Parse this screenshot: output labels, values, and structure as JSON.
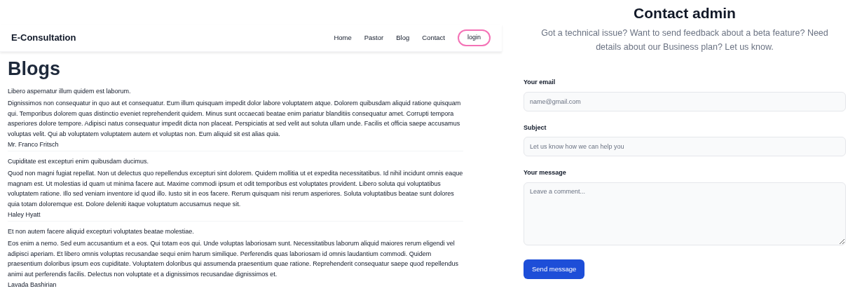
{
  "navbar": {
    "brand": "E-Consultation",
    "links": [
      {
        "label": "Home"
      },
      {
        "label": "Pastor"
      },
      {
        "label": "Blog"
      },
      {
        "label": "Contact"
      }
    ],
    "login": "login"
  },
  "blogs": {
    "heading": "Blogs",
    "posts": [
      {
        "title": "Libero aspernatur illum quidem est laborum.",
        "body": "Dignissimos non consequatur in quo aut et consequatur. Eum illum quisquam impedit dolor labore voluptatem atque. Dolorem quibusdam aliquid ratione quisquam qui. Temporibus dolorem quas distinctio eveniet reprehenderit quidem. Minus sunt occaecati beatae enim pariatur blanditiis consequatur amet. Corrupti tempora asperiores dolore tempore. Adipisci natus consequatur impedit dicta non placeat. Perspiciatis at sed velit aut soluta ullam unde. Facilis et officia saepe accusamus voluptas velit. Qui ab voluptatem voluptatem autem et voluptas non. Eum aliquid sit est alias quia.",
        "author": "Mr. Franco Fritsch"
      },
      {
        "title": "Cupiditate est excepturi enim quibusdam ducimus.",
        "body": "Quod non magni fugiat repellat. Non ut delectus quo repellendus excepturi sint dolorem. Quidem mollitia ut et expedita necessitatibus. Id nihil incidunt omnis eaque magnam est. Ut molestias id quam ut minima facere aut. Maxime commodi ipsum et odit temporibus est voluptates provident. Libero soluta qui voluptatibus voluptatem ratione. Illo sed veniam inventore id quod illo. Iusto sit in eos facere. Rerum quisquam nisi rerum asperiores. Soluta voluptatibus beatae sunt dolores quia totam doloremque est. Dolore deleniti itaque voluptatum accusamus neque sit.",
        "author": "Haley Hyatt"
      },
      {
        "title": "Et non autem facere aliquid excepturi voluptates beatae molestiae.",
        "body": "Eos enim a nemo. Sed eum accusantium et a eos. Qui totam eos qui. Unde voluptas laboriosam sunt. Necessitatibus laborum aliquid maiores rerum eligendi vel adipisci aperiam. Et libero omnis voluptas recusandae sequi enim harum similique. Perferendis quas laboriosam id omnis laudantium commodi. Quidem praesentium doloribus ipsum eos cupiditate. Voluptatem doloribus qui assumenda praesentium quae ratione. Reprehenderit consequatur saepe quod repellendus animi aut perferendis facilis. Delectus non voluptate et a dignissimos recusandae dignissimos et.",
        "author": "Lavada Bashirian"
      }
    ]
  },
  "contact": {
    "title": "Contact admin",
    "subtitle": "Got a technical issue? Want to send feedback about a beta feature? Need details about our Business plan? Let us know.",
    "fields": [
      {
        "kind": "input",
        "label": "Your email",
        "placeholder": "name@gmail.com"
      },
      {
        "kind": "input",
        "label": "Subject",
        "placeholder": "Let us know how we can help you"
      },
      {
        "kind": "textarea",
        "label": "Your message",
        "placeholder": "Leave a comment..."
      }
    ],
    "submit": "Send message"
  }
}
